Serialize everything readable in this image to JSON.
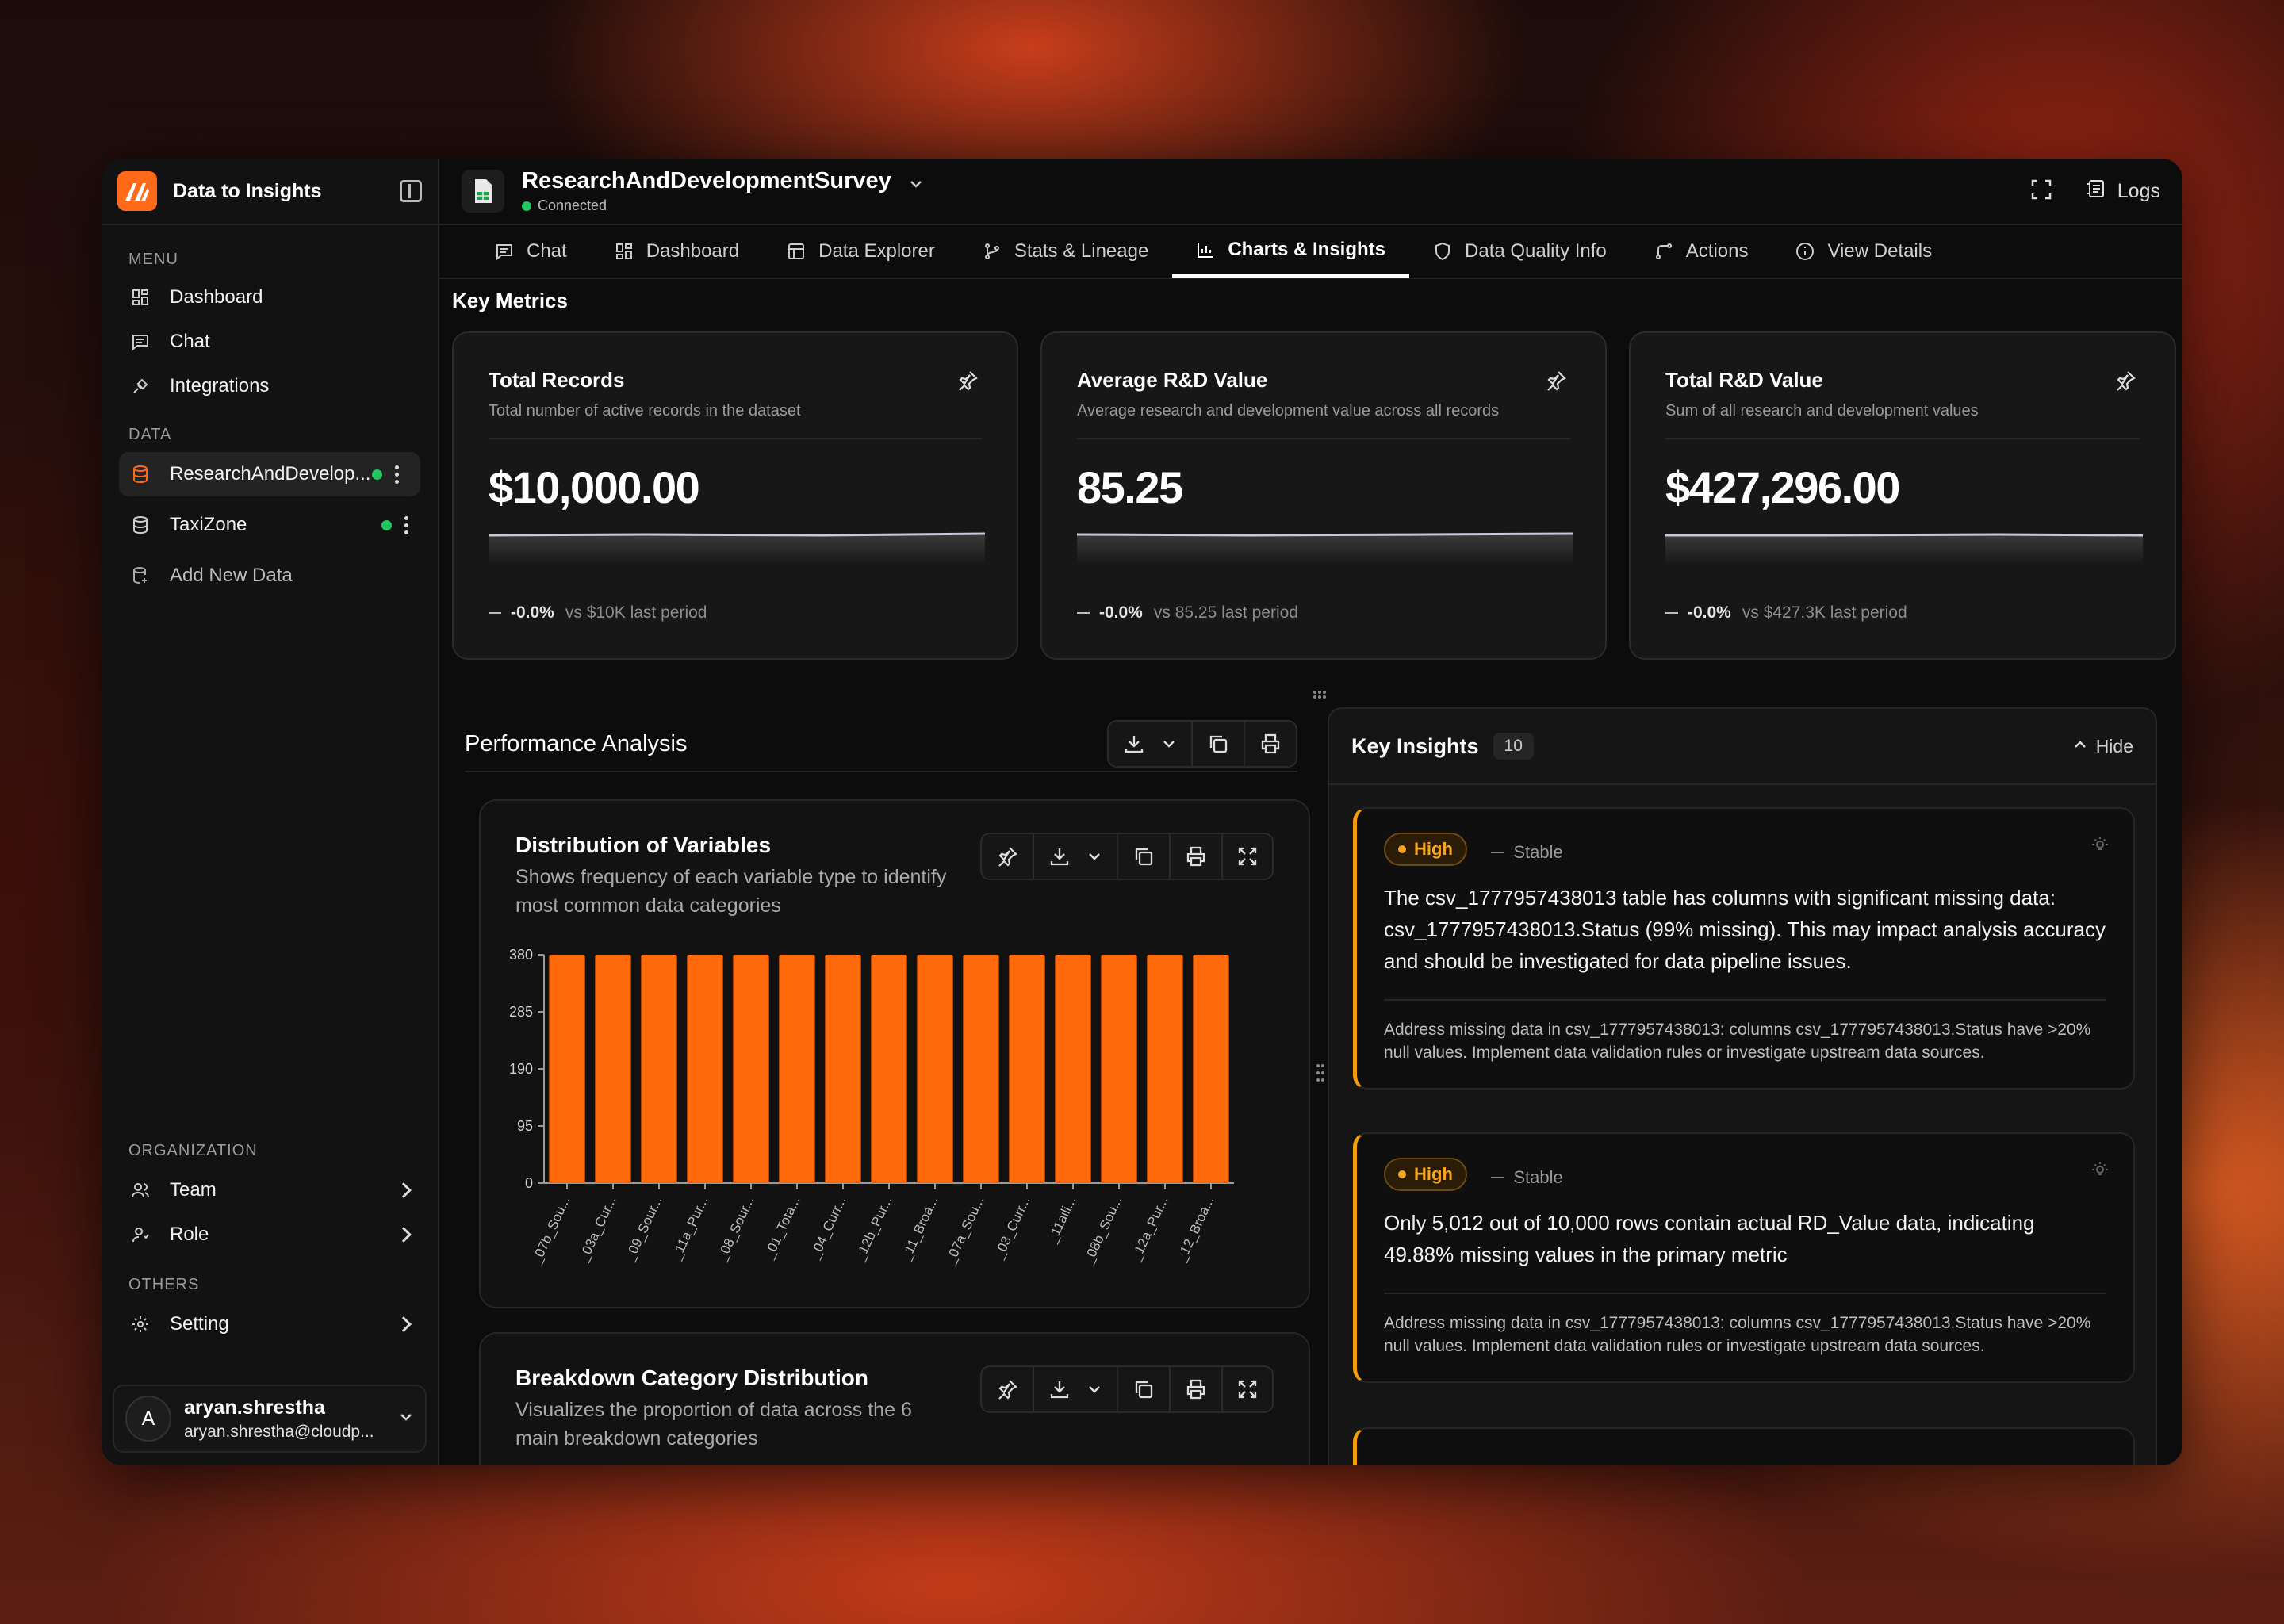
{
  "app": {
    "title": "Data to Insights"
  },
  "sidebar": {
    "menu_label": "MENU",
    "menu": [
      {
        "label": "Dashboard",
        "icon": "dashboard-icon"
      },
      {
        "label": "Chat",
        "icon": "chat-icon"
      },
      {
        "label": "Integrations",
        "icon": "plug-icon"
      }
    ],
    "data_label": "DATA",
    "data_items": [
      {
        "label": "ResearchAndDevelop...",
        "status": "connected"
      },
      {
        "label": "TaxiZone",
        "status": "connected"
      }
    ],
    "add_label": "Add New Data",
    "org_label": "ORGANIZATION",
    "org_items": [
      {
        "label": "Team"
      },
      {
        "label": "Role"
      }
    ],
    "others_label": "OTHERS",
    "others_items": [
      {
        "label": "Setting"
      }
    ],
    "user": {
      "initial": "A",
      "name": "aryan.shrestha",
      "email": "aryan.shrestha@cloudp..."
    }
  },
  "topbar": {
    "dataset_name": "ResearchAndDevelopmentSurvey",
    "dataset_status": "Connected",
    "logs_label": "Logs"
  },
  "tabs": [
    {
      "label": "Chat",
      "icon": "chat-icon"
    },
    {
      "label": "Dashboard",
      "icon": "dashboard-icon"
    },
    {
      "label": "Data Explorer",
      "icon": "table-icon"
    },
    {
      "label": "Stats & Lineage",
      "icon": "lineage-icon"
    },
    {
      "label": "Charts & Insights",
      "icon": "bar-chart-icon",
      "active": true
    },
    {
      "label": "Data Quality Info",
      "icon": "shield-icon"
    },
    {
      "label": "Actions",
      "icon": "actions-icon"
    },
    {
      "label": "View Details",
      "icon": "info-icon"
    }
  ],
  "key_metrics": {
    "title": "Key Metrics",
    "cards": [
      {
        "title": "Total Records",
        "subtitle": "Total number of active records in the dataset",
        "value": "$10,000.00",
        "change": "-0.0%",
        "compare": "vs $10K last period"
      },
      {
        "title": "Average R&D Value",
        "subtitle": "Average research and development value across all records",
        "value": "85.25",
        "change": "-0.0%",
        "compare": "vs 85.25 last period"
      },
      {
        "title": "Total R&D Value",
        "subtitle": "Sum of all research and development values",
        "value": "$427,296.00",
        "change": "-0.0%",
        "compare": "vs $427.3K last period"
      }
    ]
  },
  "performance": {
    "title": "Performance Analysis",
    "charts": [
      {
        "title": "Distribution of Variables",
        "subtitle": "Shows frequency of each variable type to identify most common data categories"
      },
      {
        "title": "Breakdown Category Distribution",
        "subtitle": "Visualizes the proportion of data across the 6 main breakdown categories"
      }
    ]
  },
  "chart_data": {
    "type": "bar",
    "categories": [
      "_07b_Sou...",
      "_03a_Cur...",
      "_09_Sour...",
      "_11a_Pur...",
      "_08_Sour...",
      "_01_Tota...",
      "_04_Curr...",
      "_12b_Pur...",
      "_11_Broa...",
      "_07a_Sou...",
      "_03_Curr...",
      "_11aili...",
      "_08b_Sou...",
      "_12a_Pur...",
      "_12_Broa..."
    ],
    "values": [
      380,
      380,
      380,
      380,
      380,
      380,
      380,
      380,
      380,
      380,
      380,
      380,
      380,
      380,
      380
    ],
    "yticks": [
      0,
      95,
      190,
      285,
      380
    ],
    "ylim": [
      0,
      380
    ],
    "color": "#ff6a0d"
  },
  "insights": {
    "title": "Key Insights",
    "count": "10",
    "hide_label": "Hide",
    "items": [
      {
        "severity": "High",
        "trend": "Stable",
        "text": "The csv_1777957438013 table has columns with significant missing data: csv_1777957438013.Status (99% missing). This may impact analysis accuracy and should be investigated for data pipeline issues.",
        "recommendation": "Address missing data in csv_1777957438013: columns csv_1777957438013.Status have >20% null values. Implement data validation rules or investigate upstream data sources."
      },
      {
        "severity": "High",
        "trend": "Stable",
        "text": "Only 5,012 out of 10,000 rows contain actual RD_Value data, indicating 49.88% missing values in the primary metric",
        "recommendation": "Address missing data in csv_1777957438013: columns csv_1777957438013.Status have >20% null values. Implement data validation rules or investigate upstream data sources."
      }
    ]
  },
  "colors": {
    "accent": "#ff6a1a",
    "bar": "#ff6a0d",
    "high": "#f5a623",
    "connected": "#22c55e"
  }
}
